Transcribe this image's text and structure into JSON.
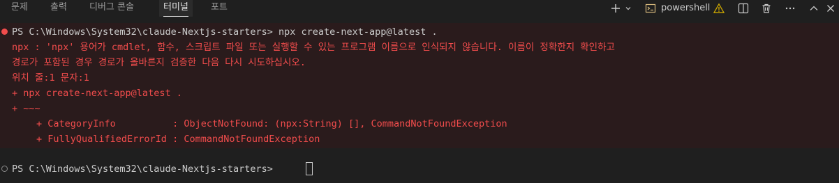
{
  "panel_tabs": [
    "문제",
    "출력",
    "디버그 콘솔",
    "터미널",
    "포트"
  ],
  "active_tab": "터미널",
  "toolbar": {
    "shell_name": "powershell",
    "icons": [
      "add-icon",
      "chevron-down-icon",
      "terminal-icon",
      "warning-icon",
      "split-icon",
      "trash-icon",
      "more-icon",
      "chevron-up-icon",
      "close-icon"
    ]
  },
  "terminal": {
    "error_block": {
      "prompt_line": "PS C:\\Windows\\System32\\claude-Nextjs-starters> npx create-next-app@latest .",
      "lines": [
        "npx : 'npx' 용어가 cmdlet, 함수, 스크립트 파일 또는 실행할 수 있는 프로그램 이름으로 인식되지 않습니다. 이름이 정확한지 확인하고",
        "경로가 포함된 경우 경로가 올바른지 검증한 다음 다시 시도하십시오.",
        "위치 줄:1 문자:1",
        "+ npx create-next-app@latest .",
        "+ ~~~"
      ],
      "indented_lines": [
        "+ CategoryInfo          : ObjectNotFound: (npx:String) [], CommandNotFoundException",
        "+ FullyQualifiedErrorId : CommandNotFoundException"
      ]
    },
    "current_prompt": "PS C:\\Windows\\System32\\claude-Nextjs-starters> "
  },
  "colors": {
    "error_text": "#f14c4c",
    "error_background": "#2a1b1c",
    "panel_background": "#1f1f1f",
    "error_dot": "#f14c4c",
    "idle_dot": "#8b8b8b",
    "shell_icon": "#d7ba7d",
    "warning_icon": "#cca700"
  }
}
